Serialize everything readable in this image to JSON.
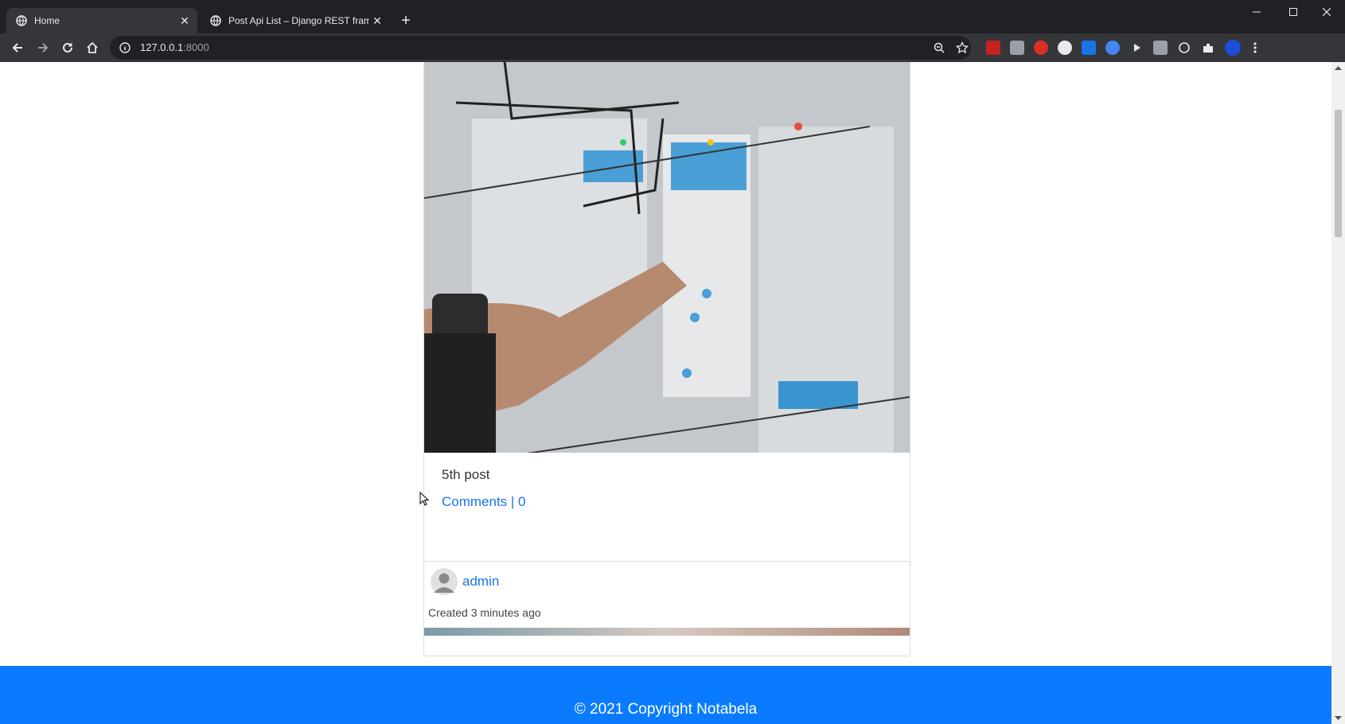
{
  "browser": {
    "tabs": [
      {
        "title": "Home",
        "active": true
      },
      {
        "title": "Post Api List – Django REST fram",
        "active": false
      }
    ],
    "url_host": "127.0.0.1",
    "url_port": ":8000"
  },
  "posts": [
    {
      "caption": "5th post",
      "comments_label": "Comments | 0"
    },
    {
      "author": "admin",
      "created": "Created 3 minutes ago"
    }
  ],
  "footer": {
    "text": "© 2021 Copyright Notabela"
  },
  "colors": {
    "footer_bg": "#0a7bff",
    "link": "#1a73e8"
  }
}
